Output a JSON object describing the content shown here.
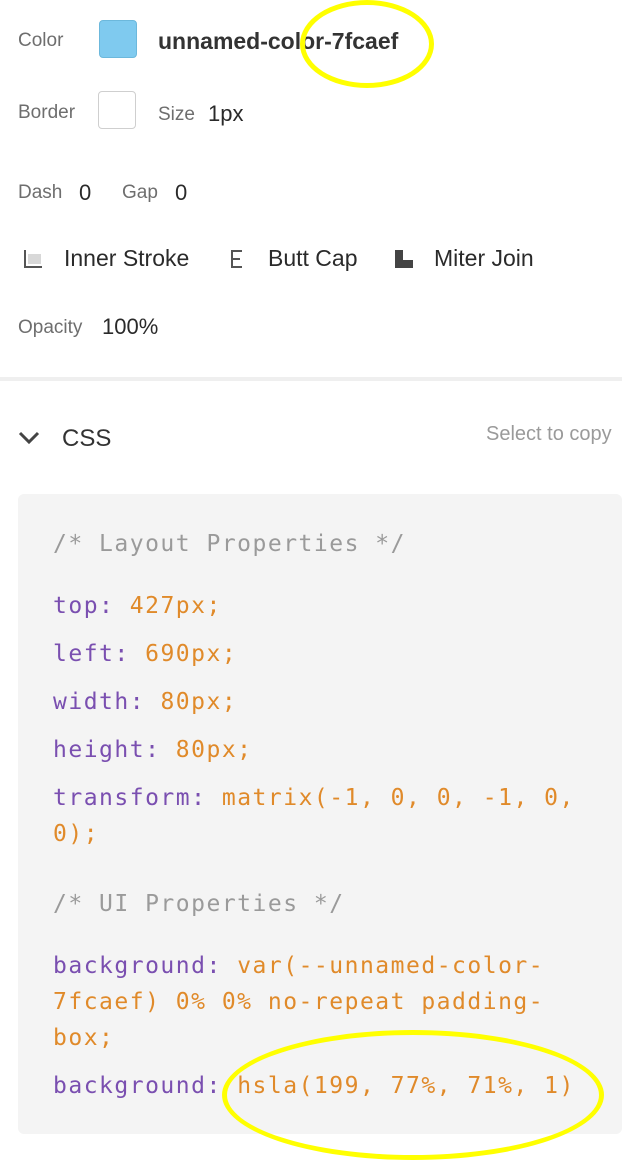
{
  "properties": {
    "color_label": "Color",
    "color_name": "unnamed-color-7fcaef",
    "color_swatch": "#7fcaef",
    "border_label": "Border",
    "size_label": "Size",
    "size_value": "1px",
    "dash_label": "Dash",
    "dash_value": "0",
    "gap_label": "Gap",
    "gap_value": "0",
    "stroke_options": [
      "Inner Stroke",
      "Butt Cap",
      "Miter Join"
    ],
    "opacity_label": "Opacity",
    "opacity_value": "100%"
  },
  "css_section": {
    "title": "CSS",
    "copy_hint": "Select to copy",
    "comment_layout": "/* Layout Properties */",
    "top_prop": "top:",
    "top_val": "427px;",
    "left_prop": "left:",
    "left_val": "690px;",
    "width_prop": "width:",
    "width_val": "80px;",
    "height_prop": "height:",
    "height_val": "80px;",
    "transform_prop": "transform:",
    "transform_val_1": "matrix(-1, 0, 0, -1, 0,",
    "transform_val_2": "0);",
    "comment_ui": "/* UI Properties */",
    "bg1_prop": "background:",
    "bg1_val_1": "var(--unnamed-color-",
    "bg1_val_2": "7fcaef) 0% 0% no-repeat padding-",
    "bg1_val_3": "box;",
    "bg2_prop": "background:",
    "bg2_val": "hsla(199, 77%, 71%, 1)"
  }
}
